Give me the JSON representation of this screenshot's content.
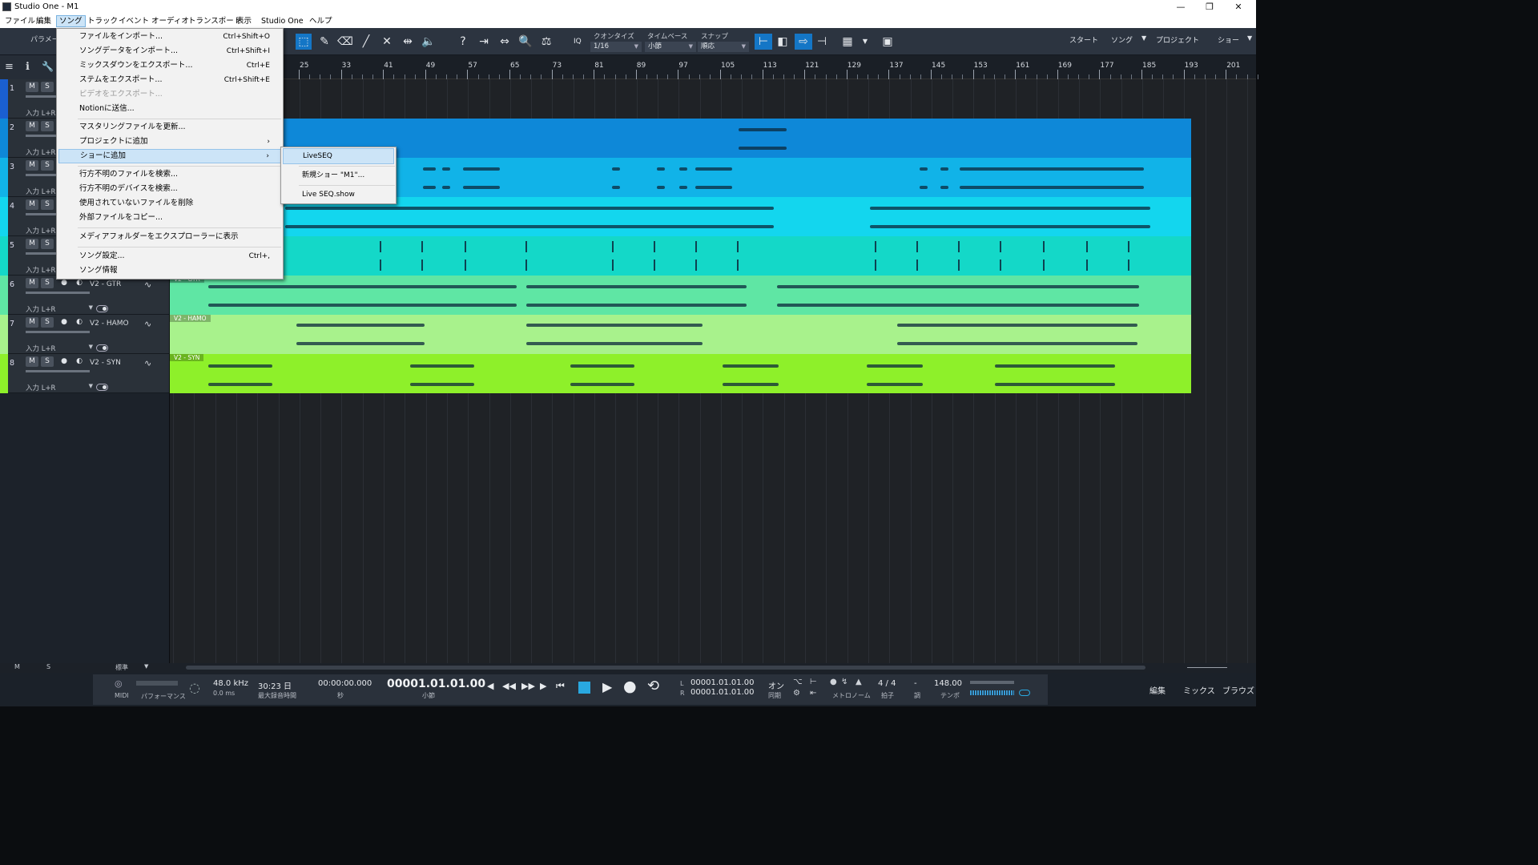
{
  "window": {
    "title": "Studio One - M1"
  },
  "menubar": [
    "ファイル",
    "編集",
    "ソング",
    "トラック",
    "イベント",
    "オーディオ",
    "トランスポート",
    "表示",
    "Studio One",
    "ヘルプ"
  ],
  "toolbar": {
    "param_label": "パラメー",
    "quantize_label": "クオンタイズ",
    "quantize_value": "1/16",
    "timebase_label": "タイムベース",
    "timebase_value": "小節",
    "snap_label": "スナップ",
    "snap_value": "順応",
    "iq_label": "IQ",
    "nav": [
      "スタート",
      "ソング",
      "プロジェクト",
      "ショー"
    ]
  },
  "ruler": [
    "25",
    "33",
    "41",
    "49",
    "57",
    "65",
    "73",
    "81",
    "89",
    "97",
    "105",
    "113",
    "121",
    "129",
    "137",
    "145",
    "153",
    "161",
    "169",
    "177",
    "185",
    "193",
    "201"
  ],
  "tracks": [
    {
      "num": "1",
      "name": "",
      "input": "入力 L+R",
      "color": "#1a5fd0"
    },
    {
      "num": "2",
      "name": "",
      "input": "入力 L+R",
      "color": "#0e88d8"
    },
    {
      "num": "3",
      "name": "",
      "input": "入力 L+R",
      "color": "#11b3e8"
    },
    {
      "num": "4",
      "name": "",
      "input": "入力 L+R",
      "color": "#13d6ee"
    },
    {
      "num": "5",
      "name": "",
      "input": "入力 L+R",
      "color": "#14d8c8"
    },
    {
      "num": "6",
      "name": "V2 - GTR",
      "input": "入力 L+R",
      "color": "#5fe6a4"
    },
    {
      "num": "7",
      "name": "V2 - HAMO",
      "input": "入力 L+R",
      "color": "#a8f28c"
    },
    {
      "num": "8",
      "name": "V2 - SYN",
      "input": "入力 L+R",
      "color": "#8ef02a"
    }
  ],
  "clips": {
    "hamo": "V2 - HAMO",
    "syn": "V2 - SYN",
    "gtr": "V2 - GTR"
  },
  "song_menu": [
    {
      "label": "ファイルをインポート...",
      "shortcut": "Ctrl+Shift+O"
    },
    {
      "label": "ソングデータをインポート...",
      "shortcut": "Ctrl+Shift+I"
    },
    {
      "label": "ミックスダウンをエクスポート...",
      "shortcut": "Ctrl+E"
    },
    {
      "label": "ステムをエクスポート...",
      "shortcut": "Ctrl+Shift+E"
    },
    {
      "label": "ビデオをエクスポート...",
      "shortcut": ""
    },
    {
      "label": "Notionに送信...",
      "shortcut": ""
    },
    {
      "label": "マスタリングファイルを更新...",
      "shortcut": ""
    },
    {
      "label": "プロジェクトに追加",
      "shortcut": ""
    },
    {
      "label": "ショーに追加",
      "shortcut": ""
    },
    {
      "label": "行方不明のファイルを検索...",
      "shortcut": ""
    },
    {
      "label": "行方不明のデバイスを検索...",
      "shortcut": ""
    },
    {
      "label": "使用されていないファイルを削除",
      "shortcut": ""
    },
    {
      "label": "外部ファイルをコピー...",
      "shortcut": ""
    },
    {
      "label": "メディアフォルダーをエクスプローラーに表示",
      "shortcut": ""
    },
    {
      "label": "ソング設定...",
      "shortcut": "Ctrl+,"
    },
    {
      "label": "ソング情報",
      "shortcut": ""
    }
  ],
  "show_submenu": [
    "LiveSEQ",
    "新規ショー \"M1\"...",
    "Live SEQ.show"
  ],
  "bottom": {
    "m": "M",
    "s": "S",
    "std": "標準"
  },
  "transport": {
    "midi": "MIDI",
    "perf": "パフォーマンス",
    "rate": "48.0 kHz",
    "latency": "0.0 ms",
    "rec_time": "30:23 日",
    "rec_label": "最大録音時間",
    "seconds": "00:00:00.000",
    "seconds_label": "秒",
    "bars": "00001.01.01.00",
    "bars_label": "小節",
    "loop_l": "00001.01.01.00",
    "loop_r": "00001.01.01.00",
    "l": "L",
    "r": "R",
    "sync": "オン",
    "sync_label": "同期",
    "metro_label": "メトロノーム",
    "sig": "4 / 4",
    "sig_label": "拍子",
    "key": "-",
    "key_label": "調",
    "tempo": "148.00",
    "tempo_label": "テンポ",
    "views": [
      "編集",
      "ミックス",
      "ブラウズ"
    ]
  }
}
